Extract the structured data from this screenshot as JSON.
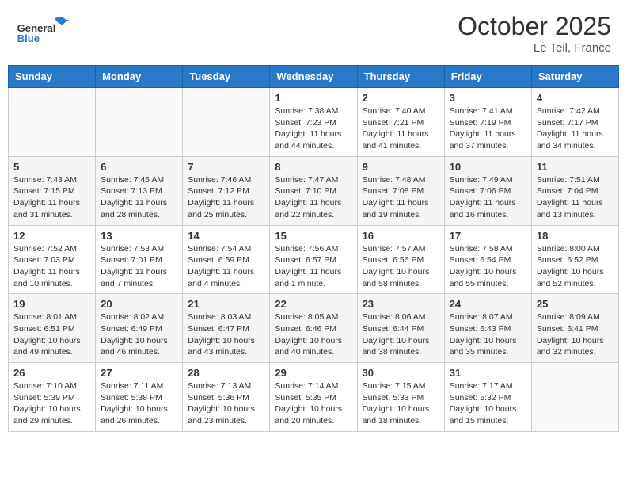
{
  "header": {
    "logo": {
      "general": "General",
      "blue": "Blue"
    },
    "title": "October 2025",
    "location": "Le Teil, France"
  },
  "calendar": {
    "weekdays": [
      "Sunday",
      "Monday",
      "Tuesday",
      "Wednesday",
      "Thursday",
      "Friday",
      "Saturday"
    ],
    "weeks": [
      [
        {
          "day": "",
          "info": ""
        },
        {
          "day": "",
          "info": ""
        },
        {
          "day": "",
          "info": ""
        },
        {
          "day": "1",
          "info": "Sunrise: 7:38 AM\nSunset: 7:23 PM\nDaylight: 11 hours\nand 44 minutes."
        },
        {
          "day": "2",
          "info": "Sunrise: 7:40 AM\nSunset: 7:21 PM\nDaylight: 11 hours\nand 41 minutes."
        },
        {
          "day": "3",
          "info": "Sunrise: 7:41 AM\nSunset: 7:19 PM\nDaylight: 11 hours\nand 37 minutes."
        },
        {
          "day": "4",
          "info": "Sunrise: 7:42 AM\nSunset: 7:17 PM\nDaylight: 11 hours\nand 34 minutes."
        }
      ],
      [
        {
          "day": "5",
          "info": "Sunrise: 7:43 AM\nSunset: 7:15 PM\nDaylight: 11 hours\nand 31 minutes."
        },
        {
          "day": "6",
          "info": "Sunrise: 7:45 AM\nSunset: 7:13 PM\nDaylight: 11 hours\nand 28 minutes."
        },
        {
          "day": "7",
          "info": "Sunrise: 7:46 AM\nSunset: 7:12 PM\nDaylight: 11 hours\nand 25 minutes."
        },
        {
          "day": "8",
          "info": "Sunrise: 7:47 AM\nSunset: 7:10 PM\nDaylight: 11 hours\nand 22 minutes."
        },
        {
          "day": "9",
          "info": "Sunrise: 7:48 AM\nSunset: 7:08 PM\nDaylight: 11 hours\nand 19 minutes."
        },
        {
          "day": "10",
          "info": "Sunrise: 7:49 AM\nSunset: 7:06 PM\nDaylight: 11 hours\nand 16 minutes."
        },
        {
          "day": "11",
          "info": "Sunrise: 7:51 AM\nSunset: 7:04 PM\nDaylight: 11 hours\nand 13 minutes."
        }
      ],
      [
        {
          "day": "12",
          "info": "Sunrise: 7:52 AM\nSunset: 7:03 PM\nDaylight: 11 hours\nand 10 minutes."
        },
        {
          "day": "13",
          "info": "Sunrise: 7:53 AM\nSunset: 7:01 PM\nDaylight: 11 hours\nand 7 minutes."
        },
        {
          "day": "14",
          "info": "Sunrise: 7:54 AM\nSunset: 6:59 PM\nDaylight: 11 hours\nand 4 minutes."
        },
        {
          "day": "15",
          "info": "Sunrise: 7:56 AM\nSunset: 6:57 PM\nDaylight: 11 hours\nand 1 minute."
        },
        {
          "day": "16",
          "info": "Sunrise: 7:57 AM\nSunset: 6:56 PM\nDaylight: 10 hours\nand 58 minutes."
        },
        {
          "day": "17",
          "info": "Sunrise: 7:58 AM\nSunset: 6:54 PM\nDaylight: 10 hours\nand 55 minutes."
        },
        {
          "day": "18",
          "info": "Sunrise: 8:00 AM\nSunset: 6:52 PM\nDaylight: 10 hours\nand 52 minutes."
        }
      ],
      [
        {
          "day": "19",
          "info": "Sunrise: 8:01 AM\nSunset: 6:51 PM\nDaylight: 10 hours\nand 49 minutes."
        },
        {
          "day": "20",
          "info": "Sunrise: 8:02 AM\nSunset: 6:49 PM\nDaylight: 10 hours\nand 46 minutes."
        },
        {
          "day": "21",
          "info": "Sunrise: 8:03 AM\nSunset: 6:47 PM\nDaylight: 10 hours\nand 43 minutes."
        },
        {
          "day": "22",
          "info": "Sunrise: 8:05 AM\nSunset: 6:46 PM\nDaylight: 10 hours\nand 40 minutes."
        },
        {
          "day": "23",
          "info": "Sunrise: 8:06 AM\nSunset: 6:44 PM\nDaylight: 10 hours\nand 38 minutes."
        },
        {
          "day": "24",
          "info": "Sunrise: 8:07 AM\nSunset: 6:43 PM\nDaylight: 10 hours\nand 35 minutes."
        },
        {
          "day": "25",
          "info": "Sunrise: 8:09 AM\nSunset: 6:41 PM\nDaylight: 10 hours\nand 32 minutes."
        }
      ],
      [
        {
          "day": "26",
          "info": "Sunrise: 7:10 AM\nSunset: 5:39 PM\nDaylight: 10 hours\nand 29 minutes."
        },
        {
          "day": "27",
          "info": "Sunrise: 7:11 AM\nSunset: 5:38 PM\nDaylight: 10 hours\nand 26 minutes."
        },
        {
          "day": "28",
          "info": "Sunrise: 7:13 AM\nSunset: 5:36 PM\nDaylight: 10 hours\nand 23 minutes."
        },
        {
          "day": "29",
          "info": "Sunrise: 7:14 AM\nSunset: 5:35 PM\nDaylight: 10 hours\nand 20 minutes."
        },
        {
          "day": "30",
          "info": "Sunrise: 7:15 AM\nSunset: 5:33 PM\nDaylight: 10 hours\nand 18 minutes."
        },
        {
          "day": "31",
          "info": "Sunrise: 7:17 AM\nSunset: 5:32 PM\nDaylight: 10 hours\nand 15 minutes."
        },
        {
          "day": "",
          "info": ""
        }
      ]
    ]
  }
}
